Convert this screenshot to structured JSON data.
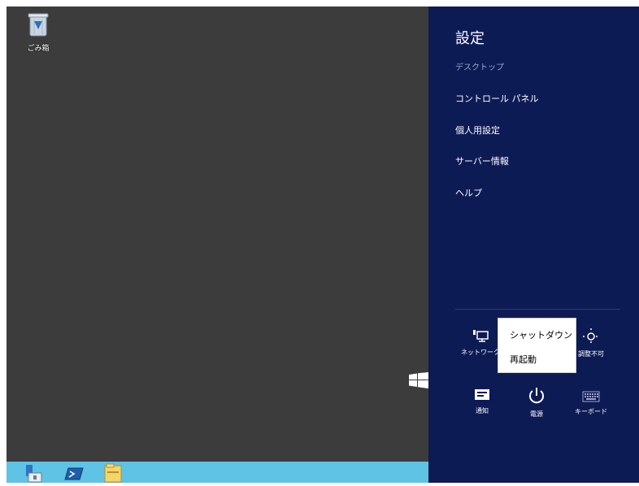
{
  "desktop": {
    "recycle_bin_label": "ごみ箱"
  },
  "taskbar": {
    "icons": [
      "server-manager-icon",
      "powershell-icon",
      "file-explorer-icon"
    ]
  },
  "charms": {
    "title": "設定",
    "subtitle": "デスクトップ",
    "menu": [
      {
        "label": "コントロール パネル"
      },
      {
        "label": "個人用設定"
      },
      {
        "label": "サーバー情報"
      },
      {
        "label": "ヘルプ"
      }
    ],
    "tiles": [
      {
        "label": "ネットワーク",
        "icon": "network-icon"
      },
      {
        "label": "調整不可",
        "icon": "brightness-icon"
      },
      {
        "label": "通知",
        "icon": "notification-icon"
      },
      {
        "label": "電源",
        "icon": "power-icon"
      },
      {
        "label": "キーボード",
        "icon": "keyboard-icon"
      }
    ]
  },
  "power_menu": {
    "shutdown_label": "シャットダウン",
    "restart_label": "再起動"
  },
  "colors": {
    "desktop_bg": "#3c3c3c",
    "charms_bg": "#0d1b55",
    "taskbar_bg": "#5fc3e6"
  }
}
